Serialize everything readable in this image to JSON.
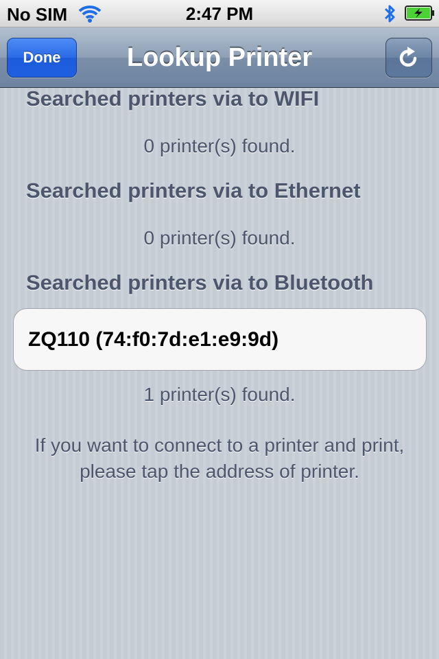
{
  "status_bar": {
    "carrier": "No SIM",
    "time": "2:47 PM",
    "icons": [
      "wifi-icon",
      "bluetooth-icon",
      "battery-charging-icon"
    ]
  },
  "nav": {
    "done_label": "Done",
    "title": "Lookup Printer",
    "refresh_icon": "refresh-icon"
  },
  "sections": [
    {
      "header": "Searched printers via to WIFI",
      "footer": "0 printer(s) found.",
      "printers": []
    },
    {
      "header": "Searched printers via to Ethernet",
      "footer": "0 printer(s) found.",
      "printers": []
    },
    {
      "header": "Searched printers via to Bluetooth",
      "footer": "1 printer(s) found.",
      "printers": [
        "ZQ110 (74:f0:7d:e1:e9:9d)"
      ]
    }
  ],
  "hint": "If you want to connect to a printer and print, please tap the address of printer.",
  "colors": {
    "nav_accent": "#6d83a0",
    "done_button": "#2b6ae6",
    "section_text": "#4c566c",
    "battery_charging": "#4cd137"
  }
}
